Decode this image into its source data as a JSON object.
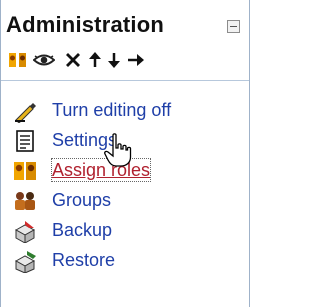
{
  "block": {
    "title": "Administration",
    "controls": [
      "roles-icon",
      "eye-icon",
      "move-icon",
      "up-arrow-icon",
      "down-arrow-icon",
      "right-arrow-icon"
    ],
    "items": [
      {
        "label": "Turn editing off",
        "icon": "edit-icon",
        "active": false
      },
      {
        "label": "Settings",
        "icon": "settings-icon",
        "active": false
      },
      {
        "label": "Assign roles",
        "icon": "roles-icon",
        "active": true
      },
      {
        "label": "Groups",
        "icon": "groups-icon",
        "active": false
      },
      {
        "label": "Backup",
        "icon": "backup-icon",
        "active": false
      },
      {
        "label": "Restore",
        "icon": "restore-icon",
        "active": false
      }
    ]
  },
  "colors": {
    "link": "#1f3fa8",
    "active_link": "#b0212f",
    "border": "#9fb2c9"
  }
}
